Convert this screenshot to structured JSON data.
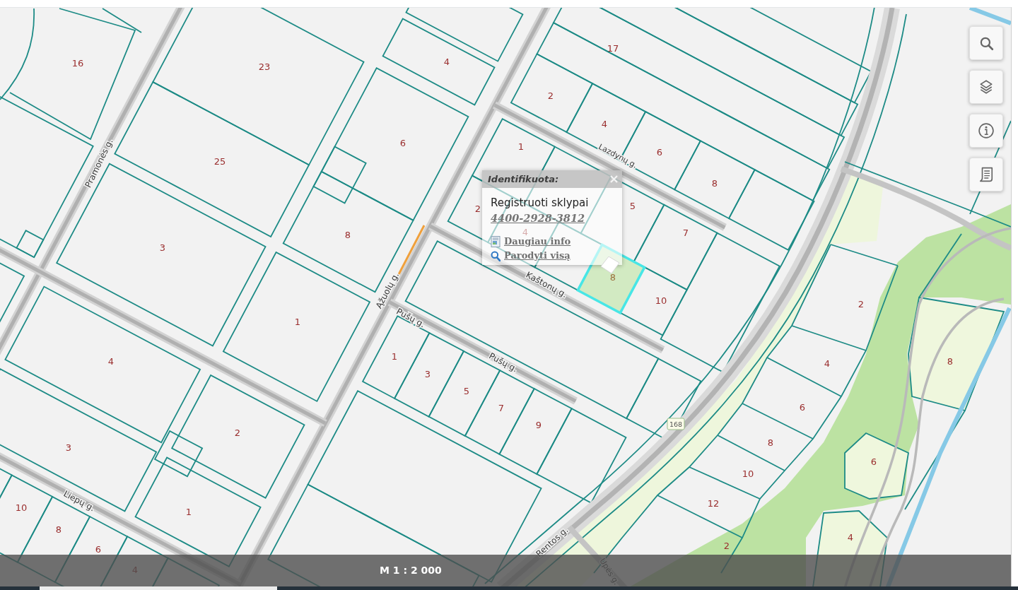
{
  "map": {
    "parcels": [
      {
        "number": "17",
        "selected": false
      },
      {
        "number": "16",
        "selected": false
      },
      {
        "number": "23",
        "selected": false
      },
      {
        "number": "4",
        "selected": false
      },
      {
        "number": "2",
        "selected": false
      },
      {
        "number": "4",
        "selected": false
      },
      {
        "number": "6",
        "selected": false
      },
      {
        "number": "1",
        "selected": false
      },
      {
        "number": "6",
        "selected": false
      },
      {
        "number": "25",
        "selected": false
      },
      {
        "number": "8",
        "selected": false
      },
      {
        "number": "2",
        "selected": false
      },
      {
        "number": "5",
        "selected": false
      },
      {
        "number": "8",
        "selected": false
      },
      {
        "number": "4",
        "selected": false
      },
      {
        "number": "7",
        "selected": false
      },
      {
        "number": "3",
        "selected": false
      },
      {
        "number": "8",
        "selected": true
      },
      {
        "number": "10",
        "selected": false
      },
      {
        "number": "2",
        "selected": false
      },
      {
        "number": "1",
        "selected": false
      },
      {
        "number": "4",
        "selected": false
      },
      {
        "number": "1",
        "selected": false
      },
      {
        "number": "4",
        "selected": false
      },
      {
        "number": "8",
        "selected": false
      },
      {
        "number": "3",
        "selected": false
      },
      {
        "number": "5",
        "selected": false
      },
      {
        "number": "7",
        "selected": false
      },
      {
        "number": "6",
        "selected": false
      },
      {
        "number": "9",
        "selected": false
      },
      {
        "number": "2",
        "selected": false
      },
      {
        "number": "3",
        "selected": false
      },
      {
        "number": "8",
        "selected": false
      },
      {
        "number": "6",
        "selected": false
      },
      {
        "number": "10",
        "selected": false
      },
      {
        "number": "10",
        "selected": false
      },
      {
        "number": "1",
        "selected": false
      },
      {
        "number": "12",
        "selected": false
      },
      {
        "number": "8",
        "selected": false
      },
      {
        "number": "4",
        "selected": false
      },
      {
        "number": "6",
        "selected": false
      },
      {
        "number": "2",
        "selected": false
      },
      {
        "number": "4",
        "selected": false
      }
    ],
    "streets": [
      "Pramonės g.",
      "Lazdynų g.",
      "Kaštonų g.",
      "Ąžuolų g.",
      "Pušų g.",
      "Pušų g.",
      "Liepų g.",
      "Rentos g.",
      "Upės g."
    ],
    "road_number": "168"
  },
  "popup": {
    "title": "Identifikuota:",
    "layer": "Registruoti sklypai",
    "parcel_id": "4400-2928-3812",
    "links": [
      "Daugiau info",
      "Parodyti visą"
    ]
  },
  "scale": "M 1 : 2 000"
}
